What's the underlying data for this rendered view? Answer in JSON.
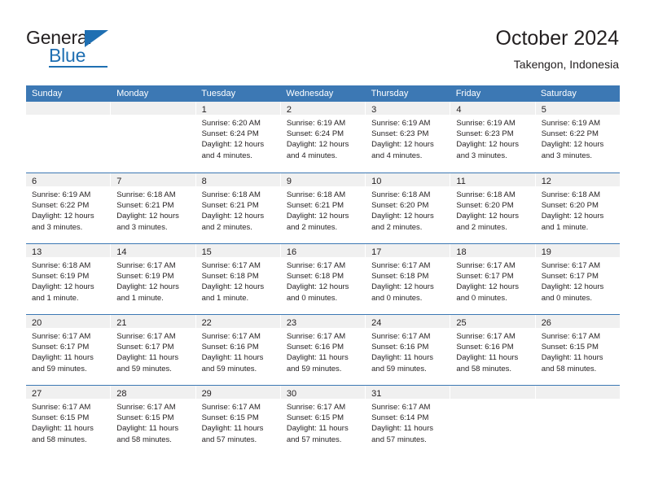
{
  "brand": {
    "name_top": "General",
    "name_bottom": "Blue"
  },
  "header": {
    "title": "October 2024",
    "subtitle": "Takengon, Indonesia"
  },
  "colors": {
    "header_blue": "#3c78b4",
    "brand_blue": "#1f6fb2",
    "day_band": "#f0f0f0",
    "text": "#231f20"
  },
  "weekdays": [
    "Sunday",
    "Monday",
    "Tuesday",
    "Wednesday",
    "Thursday",
    "Friday",
    "Saturday"
  ],
  "calendar": {
    "month": "October",
    "year": 2024,
    "location": "Takengon, Indonesia",
    "weeks": [
      [
        {
          "day": "",
          "empty": true
        },
        {
          "day": "",
          "empty": true
        },
        {
          "day": "1",
          "sunrise": "Sunrise: 6:20 AM",
          "sunset": "Sunset: 6:24 PM",
          "daylight_l1": "Daylight: 12 hours",
          "daylight_l2": "and 4 minutes."
        },
        {
          "day": "2",
          "sunrise": "Sunrise: 6:19 AM",
          "sunset": "Sunset: 6:24 PM",
          "daylight_l1": "Daylight: 12 hours",
          "daylight_l2": "and 4 minutes."
        },
        {
          "day": "3",
          "sunrise": "Sunrise: 6:19 AM",
          "sunset": "Sunset: 6:23 PM",
          "daylight_l1": "Daylight: 12 hours",
          "daylight_l2": "and 4 minutes."
        },
        {
          "day": "4",
          "sunrise": "Sunrise: 6:19 AM",
          "sunset": "Sunset: 6:23 PM",
          "daylight_l1": "Daylight: 12 hours",
          "daylight_l2": "and 3 minutes."
        },
        {
          "day": "5",
          "sunrise": "Sunrise: 6:19 AM",
          "sunset": "Sunset: 6:22 PM",
          "daylight_l1": "Daylight: 12 hours",
          "daylight_l2": "and 3 minutes."
        }
      ],
      [
        {
          "day": "6",
          "sunrise": "Sunrise: 6:19 AM",
          "sunset": "Sunset: 6:22 PM",
          "daylight_l1": "Daylight: 12 hours",
          "daylight_l2": "and 3 minutes."
        },
        {
          "day": "7",
          "sunrise": "Sunrise: 6:18 AM",
          "sunset": "Sunset: 6:21 PM",
          "daylight_l1": "Daylight: 12 hours",
          "daylight_l2": "and 3 minutes."
        },
        {
          "day": "8",
          "sunrise": "Sunrise: 6:18 AM",
          "sunset": "Sunset: 6:21 PM",
          "daylight_l1": "Daylight: 12 hours",
          "daylight_l2": "and 2 minutes."
        },
        {
          "day": "9",
          "sunrise": "Sunrise: 6:18 AM",
          "sunset": "Sunset: 6:21 PM",
          "daylight_l1": "Daylight: 12 hours",
          "daylight_l2": "and 2 minutes."
        },
        {
          "day": "10",
          "sunrise": "Sunrise: 6:18 AM",
          "sunset": "Sunset: 6:20 PM",
          "daylight_l1": "Daylight: 12 hours",
          "daylight_l2": "and 2 minutes."
        },
        {
          "day": "11",
          "sunrise": "Sunrise: 6:18 AM",
          "sunset": "Sunset: 6:20 PM",
          "daylight_l1": "Daylight: 12 hours",
          "daylight_l2": "and 2 minutes."
        },
        {
          "day": "12",
          "sunrise": "Sunrise: 6:18 AM",
          "sunset": "Sunset: 6:20 PM",
          "daylight_l1": "Daylight: 12 hours",
          "daylight_l2": "and 1 minute."
        }
      ],
      [
        {
          "day": "13",
          "sunrise": "Sunrise: 6:18 AM",
          "sunset": "Sunset: 6:19 PM",
          "daylight_l1": "Daylight: 12 hours",
          "daylight_l2": "and 1 minute."
        },
        {
          "day": "14",
          "sunrise": "Sunrise: 6:17 AM",
          "sunset": "Sunset: 6:19 PM",
          "daylight_l1": "Daylight: 12 hours",
          "daylight_l2": "and 1 minute."
        },
        {
          "day": "15",
          "sunrise": "Sunrise: 6:17 AM",
          "sunset": "Sunset: 6:18 PM",
          "daylight_l1": "Daylight: 12 hours",
          "daylight_l2": "and 1 minute."
        },
        {
          "day": "16",
          "sunrise": "Sunrise: 6:17 AM",
          "sunset": "Sunset: 6:18 PM",
          "daylight_l1": "Daylight: 12 hours",
          "daylight_l2": "and 0 minutes."
        },
        {
          "day": "17",
          "sunrise": "Sunrise: 6:17 AM",
          "sunset": "Sunset: 6:18 PM",
          "daylight_l1": "Daylight: 12 hours",
          "daylight_l2": "and 0 minutes."
        },
        {
          "day": "18",
          "sunrise": "Sunrise: 6:17 AM",
          "sunset": "Sunset: 6:17 PM",
          "daylight_l1": "Daylight: 12 hours",
          "daylight_l2": "and 0 minutes."
        },
        {
          "day": "19",
          "sunrise": "Sunrise: 6:17 AM",
          "sunset": "Sunset: 6:17 PM",
          "daylight_l1": "Daylight: 12 hours",
          "daylight_l2": "and 0 minutes."
        }
      ],
      [
        {
          "day": "20",
          "sunrise": "Sunrise: 6:17 AM",
          "sunset": "Sunset: 6:17 PM",
          "daylight_l1": "Daylight: 11 hours",
          "daylight_l2": "and 59 minutes."
        },
        {
          "day": "21",
          "sunrise": "Sunrise: 6:17 AM",
          "sunset": "Sunset: 6:17 PM",
          "daylight_l1": "Daylight: 11 hours",
          "daylight_l2": "and 59 minutes."
        },
        {
          "day": "22",
          "sunrise": "Sunrise: 6:17 AM",
          "sunset": "Sunset: 6:16 PM",
          "daylight_l1": "Daylight: 11 hours",
          "daylight_l2": "and 59 minutes."
        },
        {
          "day": "23",
          "sunrise": "Sunrise: 6:17 AM",
          "sunset": "Sunset: 6:16 PM",
          "daylight_l1": "Daylight: 11 hours",
          "daylight_l2": "and 59 minutes."
        },
        {
          "day": "24",
          "sunrise": "Sunrise: 6:17 AM",
          "sunset": "Sunset: 6:16 PM",
          "daylight_l1": "Daylight: 11 hours",
          "daylight_l2": "and 59 minutes."
        },
        {
          "day": "25",
          "sunrise": "Sunrise: 6:17 AM",
          "sunset": "Sunset: 6:16 PM",
          "daylight_l1": "Daylight: 11 hours",
          "daylight_l2": "and 58 minutes."
        },
        {
          "day": "26",
          "sunrise": "Sunrise: 6:17 AM",
          "sunset": "Sunset: 6:15 PM",
          "daylight_l1": "Daylight: 11 hours",
          "daylight_l2": "and 58 minutes."
        }
      ],
      [
        {
          "day": "27",
          "sunrise": "Sunrise: 6:17 AM",
          "sunset": "Sunset: 6:15 PM",
          "daylight_l1": "Daylight: 11 hours",
          "daylight_l2": "and 58 minutes."
        },
        {
          "day": "28",
          "sunrise": "Sunrise: 6:17 AM",
          "sunset": "Sunset: 6:15 PM",
          "daylight_l1": "Daylight: 11 hours",
          "daylight_l2": "and 58 minutes."
        },
        {
          "day": "29",
          "sunrise": "Sunrise: 6:17 AM",
          "sunset": "Sunset: 6:15 PM",
          "daylight_l1": "Daylight: 11 hours",
          "daylight_l2": "and 57 minutes."
        },
        {
          "day": "30",
          "sunrise": "Sunrise: 6:17 AM",
          "sunset": "Sunset: 6:15 PM",
          "daylight_l1": "Daylight: 11 hours",
          "daylight_l2": "and 57 minutes."
        },
        {
          "day": "31",
          "sunrise": "Sunrise: 6:17 AM",
          "sunset": "Sunset: 6:14 PM",
          "daylight_l1": "Daylight: 11 hours",
          "daylight_l2": "and 57 minutes."
        },
        {
          "day": "",
          "empty": true
        },
        {
          "day": "",
          "empty": true
        }
      ]
    ]
  }
}
